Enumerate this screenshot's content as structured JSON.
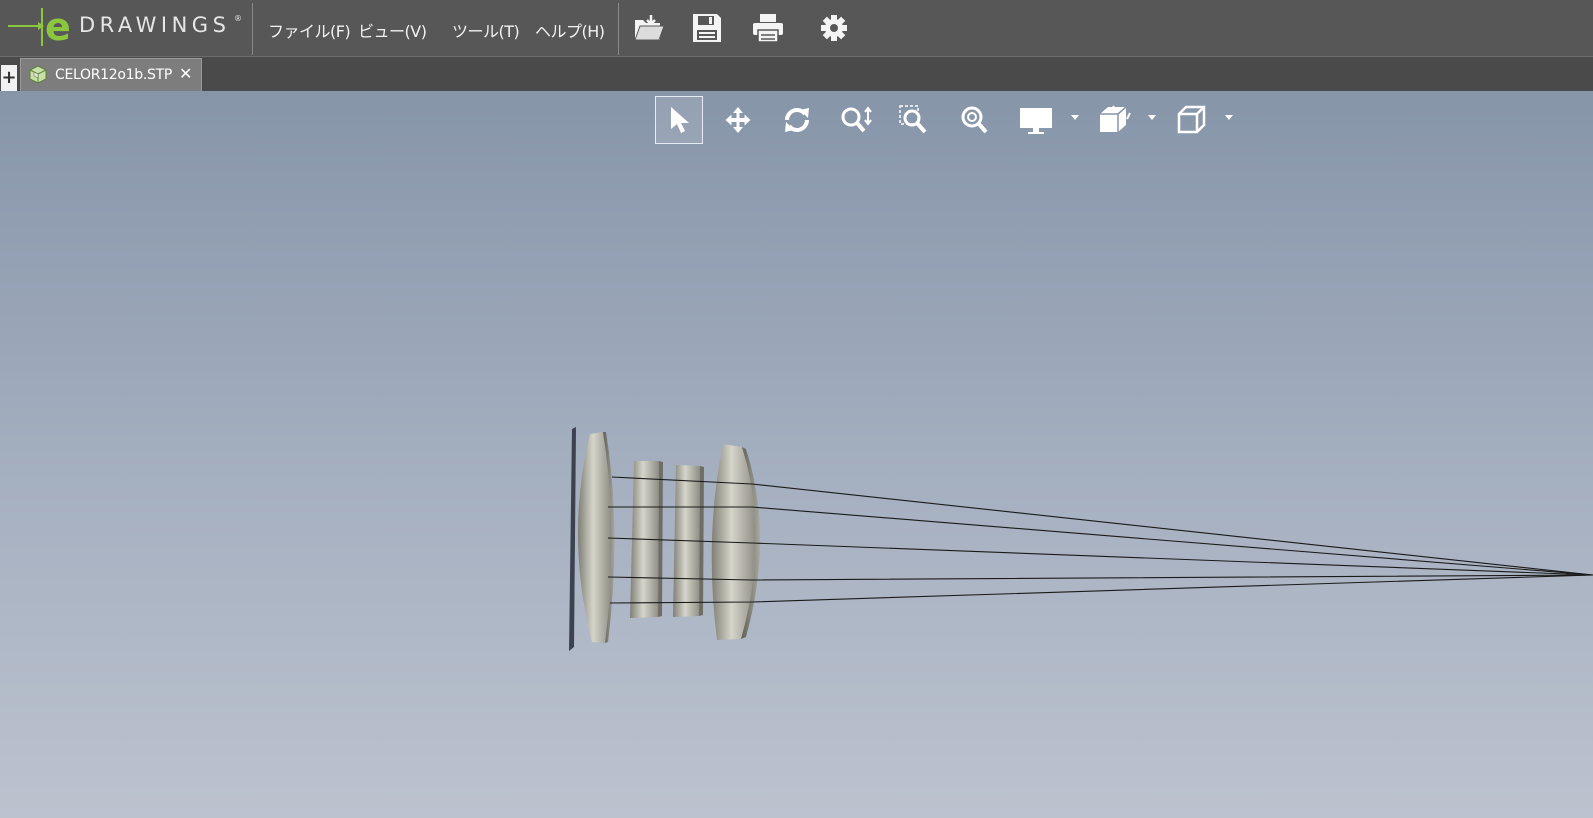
{
  "app": {
    "logo_text": "DRAWINGS",
    "logo_mark": "e",
    "logo_reg": "®",
    "accent": "#8cc63f"
  },
  "menu": [
    {
      "label": "ファイル(F)"
    },
    {
      "label": "ビュー(V)"
    },
    {
      "label": "ツール(T)"
    },
    {
      "label": "ヘルプ(H)"
    }
  ],
  "toolbar_icons": [
    "open-file-icon",
    "save-icon",
    "print-icon",
    "gear-icon"
  ],
  "tabs": {
    "new_tab_label": "+",
    "document": {
      "label": "CELOR12o1b.STP",
      "close_label": "✕"
    }
  },
  "view_toolbar": [
    "select-pointer-icon",
    "pan-icon",
    "rotate-icon",
    "zoom-icon",
    "zoom-to-area-icon",
    "zoom-to-fit-icon",
    "display-style-icon",
    "section-view-icon",
    "standard-views-icon"
  ],
  "colors": {
    "title_bar": "#575757",
    "tab_bar": "#4a4a4a",
    "viewport_top": "#8795a9",
    "viewport_bottom": "#bcc3cf",
    "lens": "#b7b6a9"
  }
}
